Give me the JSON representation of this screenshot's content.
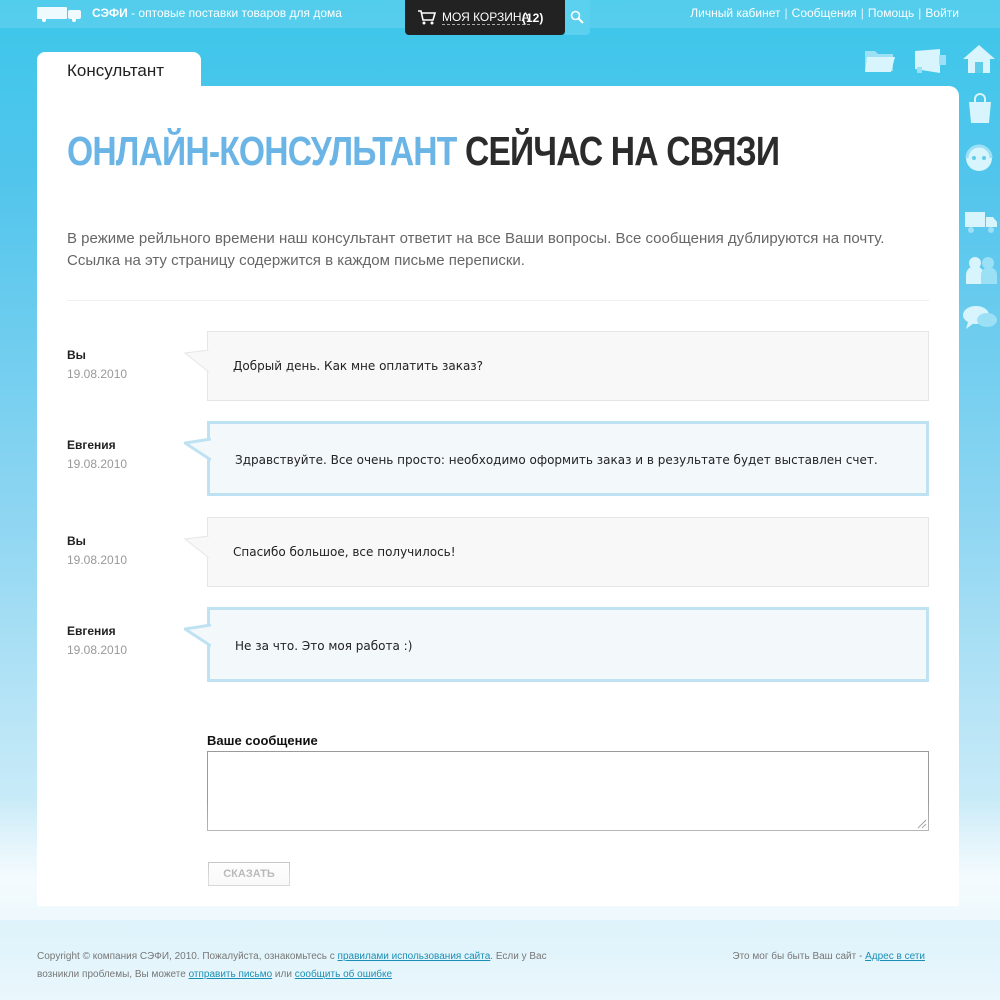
{
  "header": {
    "brand_name": "СЭФИ",
    "brand_tagline": " - оптовые поставки товаров для дома",
    "cart_label": "МОЯ КОРЗИНА",
    "cart_count": "(12)",
    "links": [
      "Личный кабинет",
      "Сообщения",
      "Помощь",
      "Войти"
    ],
    "separator": "|"
  },
  "side_icons": [
    "folder-icon",
    "megaphone-icon",
    "home-icon",
    "shopping-bag-icon",
    "support-headset-icon",
    "truck-icon",
    "users-icon",
    "chat-bubbles-icon"
  ],
  "tab": {
    "label": "Консультант"
  },
  "main": {
    "heading_highlight": "ОНЛАЙН-КОНСУЛЬТАНТ",
    "heading_rest": " СЕЙЧАС НА СВЯЗИ",
    "intro": "В режиме рейльного времени наш консультант ответит на все Ваши вопросы. Все сообщения дублируются на почту. Ссылка на эту страницу содержится в каждом письме переписки."
  },
  "messages": [
    {
      "author": "Вы",
      "date": "19.08.2010",
      "text": "Добрый день. Как мне оплатить заказ?",
      "role": "user"
    },
    {
      "author": "Евгения",
      "date": "19.08.2010",
      "text": "Здравствуйте. Все очень просто: необходимо оформить заказ и в результате будет выставлен счет.",
      "role": "agent"
    },
    {
      "author": "Вы",
      "date": "19.08.2010",
      "text": "Спасибо большое, все получилось!",
      "role": "user"
    },
    {
      "author": "Евгения",
      "date": "19.08.2010",
      "text": "Не за что. Это моя работа :)",
      "role": "agent"
    }
  ],
  "form": {
    "label": "Ваше сообщение",
    "textarea_value": "",
    "submit_label": "СКАЗАТЬ"
  },
  "footer": {
    "left_1": "Copyright © компания СЭФИ, 2010. Пожалуйста, ознакомьтесь с ",
    "rules_link": "правилами использования сайта",
    "left_2": ". Если у Вас возникли проблемы, Вы можете ",
    "send_letter_link": "отправить письмо",
    "left_3": " или ",
    "report_error_link": "сообщить об ошибке",
    "right_text": "Это мог бы быть Ваш сайт - ",
    "right_link": "Адрес в сети"
  },
  "colors": {
    "accent_blue": "#6ab4e6",
    "sky_top": "#3cc6ea",
    "agent_bubble_border": "#bfe2f2",
    "link": "#1a8fb5"
  }
}
